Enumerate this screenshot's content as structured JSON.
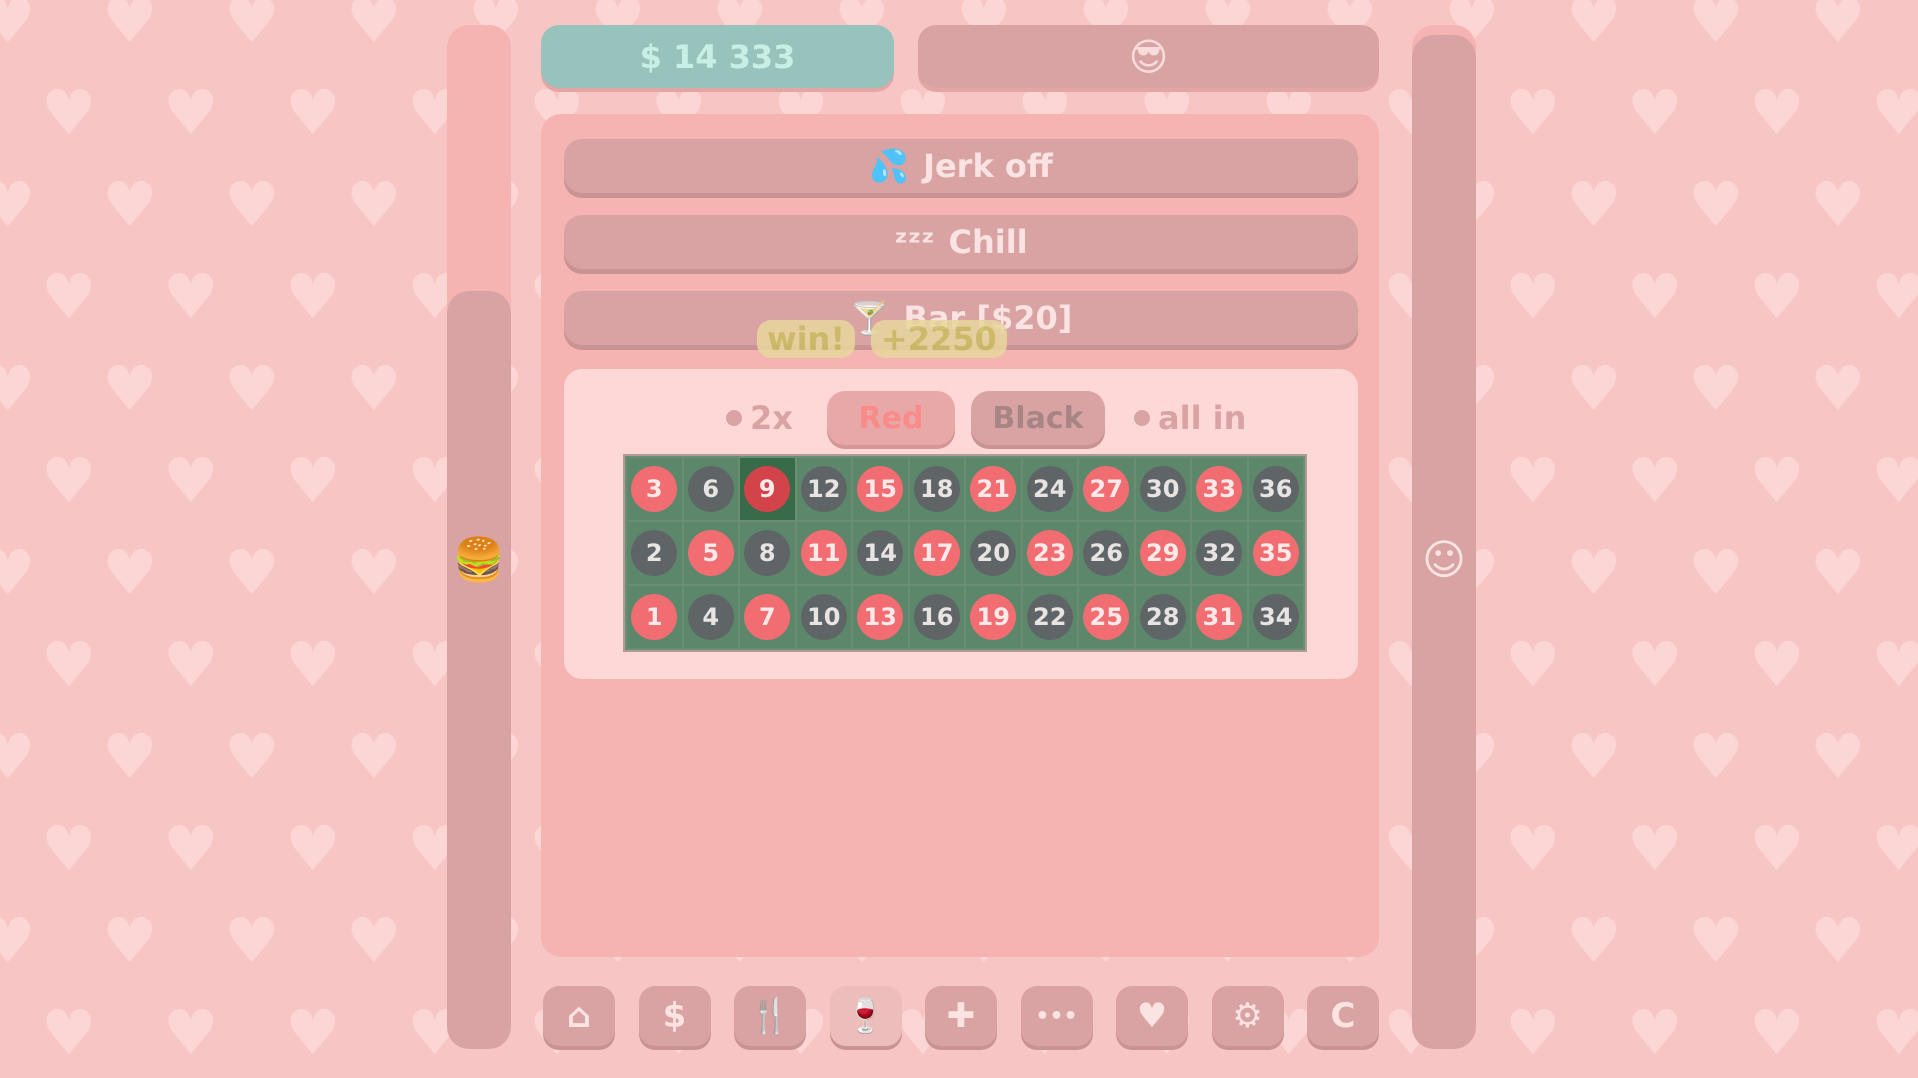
{
  "stats": {
    "money": "$ 14 333",
    "mood_icon": "cool-face-icon",
    "hunger_level": 0.74,
    "happiness_level": 0.99
  },
  "actions": [
    {
      "label": "Jerk off",
      "icon": "splash-icon",
      "glyph": "💦"
    },
    {
      "label": "Chill",
      "icon": "sleep-zzz-icon",
      "glyph": "ᶻᶻᶻ"
    },
    {
      "label": "Bar  [$20]",
      "icon": "cocktail-icon",
      "glyph": "🍸"
    }
  ],
  "win_popup": {
    "text": "win!",
    "amount": "+2250"
  },
  "roulette": {
    "option_2x": "2x",
    "red_label": "Red",
    "black_label": "Black",
    "option_allin": "all in",
    "selected": 9,
    "rows": [
      [
        3,
        6,
        9,
        12,
        15,
        18,
        21,
        24,
        27,
        30,
        33,
        36
      ],
      [
        2,
        5,
        8,
        11,
        14,
        17,
        20,
        23,
        26,
        29,
        32,
        35
      ],
      [
        1,
        4,
        7,
        10,
        13,
        16,
        19,
        22,
        25,
        28,
        31,
        34
      ]
    ],
    "red_numbers": [
      1,
      3,
      5,
      7,
      9,
      11,
      13,
      15,
      17,
      19,
      21,
      23,
      25,
      27,
      29,
      31,
      33,
      35
    ]
  },
  "nav": [
    {
      "name": "home-icon",
      "glyph": "⌂",
      "active": false
    },
    {
      "name": "dollar-icon",
      "glyph": "$",
      "active": false
    },
    {
      "name": "fork-knife-icon",
      "glyph": "🍴",
      "active": false
    },
    {
      "name": "wine-glass-icon",
      "glyph": "🍷",
      "active": true
    },
    {
      "name": "plus-icon",
      "glyph": "✚",
      "active": false
    },
    {
      "name": "more-dots-icon",
      "glyph": "•••",
      "active": false
    },
    {
      "name": "heart-icon",
      "glyph": "♥",
      "active": false
    },
    {
      "name": "gear-icon",
      "glyph": "⚙",
      "active": false
    },
    {
      "name": "c-icon",
      "glyph": "C",
      "active": false
    }
  ],
  "side_icons": {
    "left": "burger-icon",
    "left_glyph": "🍔",
    "right": "smiley-icon",
    "right_glyph": "☺"
  }
}
